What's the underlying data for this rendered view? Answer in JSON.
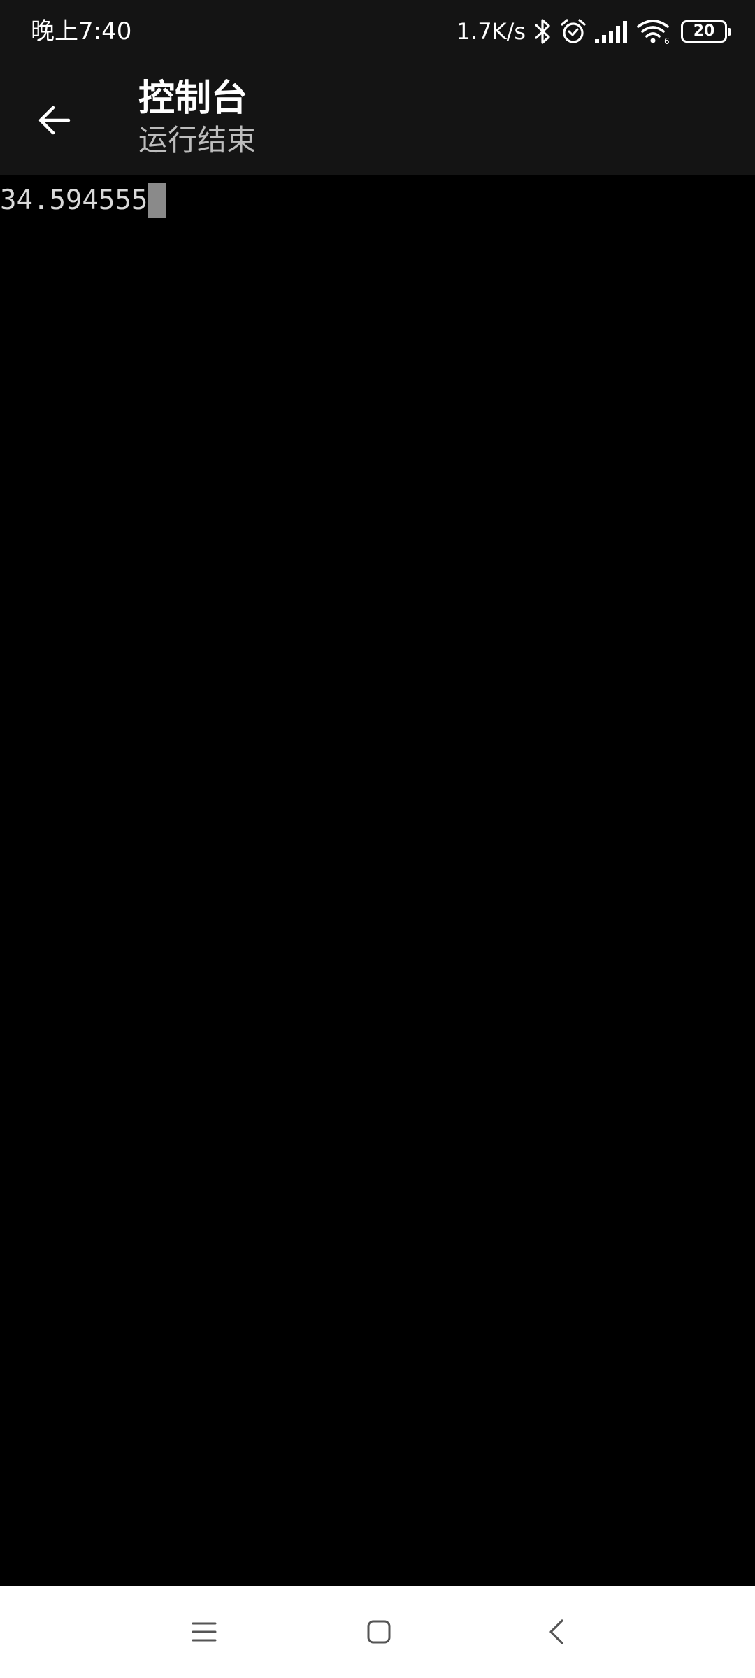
{
  "status_bar": {
    "time": "晚上7:40",
    "net_speed": "1.7K/s",
    "battery_level": "20",
    "icons": [
      "bluetooth-icon",
      "alarm-icon",
      "signal-icon",
      "wifi-icon",
      "battery-icon"
    ]
  },
  "app_bar": {
    "title": "控制台",
    "subtitle": "运行结束",
    "back_icon": "arrow-left-icon"
  },
  "console": {
    "output": "34.594555"
  },
  "nav_bar": {
    "icons": [
      "menu-icon",
      "home-icon",
      "back-icon"
    ]
  },
  "colors": {
    "bar_background": "#141414",
    "console_background": "#000000",
    "console_text": "#d9d9d9",
    "cursor": "#8a8a8a",
    "nav_background": "#ffffff"
  }
}
